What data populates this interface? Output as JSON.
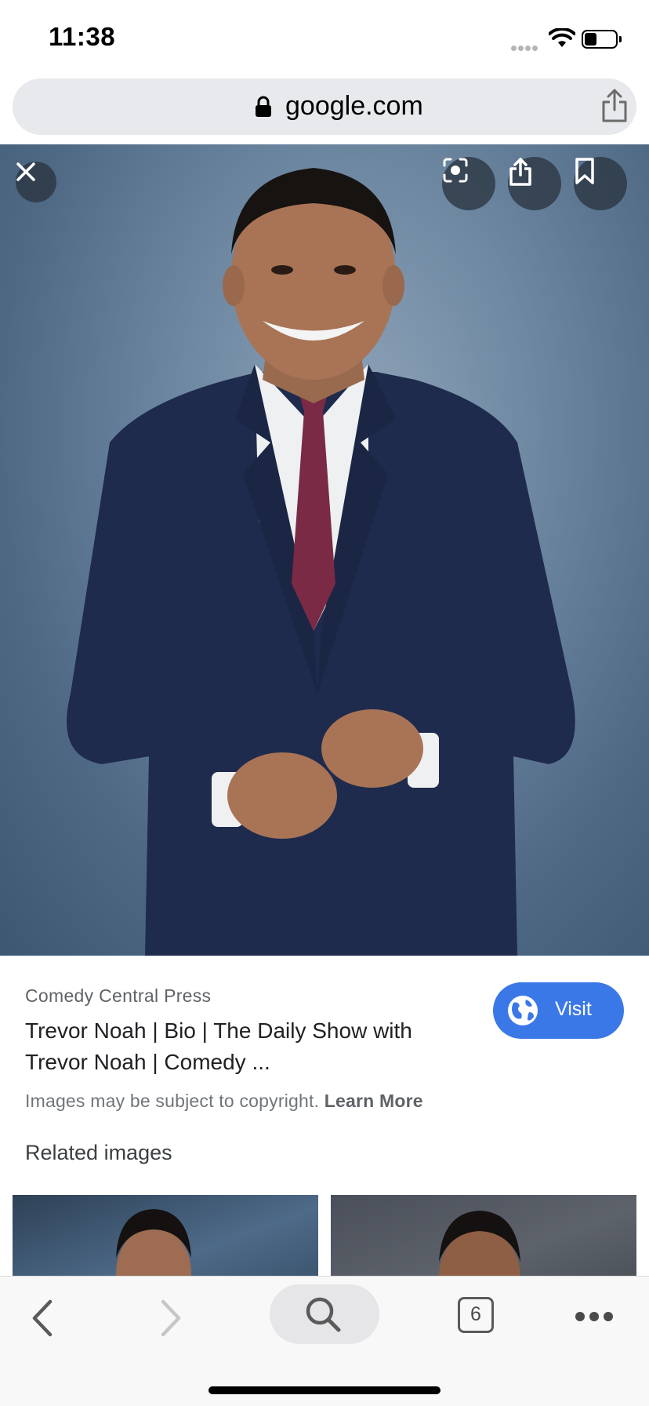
{
  "status_bar": {
    "time": "11:38",
    "battery_level": 0.35
  },
  "address_bar": {
    "url": "google.com",
    "icons": [
      "lock-icon",
      "share-icon"
    ]
  },
  "image_viewer": {
    "buttons": [
      "close-icon",
      "lens-icon",
      "share-icon",
      "bookmark-icon"
    ]
  },
  "result": {
    "source": "Comedy Central Press",
    "title": "Trevor Noah | Bio | The Daily Show with Trevor Noah | Comedy ...",
    "visit_label": "Visit",
    "copyright_text": "Images may be subject to copyright.",
    "learn_more": "Learn More",
    "related_heading": "Related images"
  },
  "toolbar": {
    "tab_count": "6",
    "icons": [
      "back-icon",
      "forward-icon",
      "search-icon",
      "tabs-icon",
      "more-icon"
    ]
  },
  "colors": {
    "accent": "#3b78e7",
    "address_bar_bg": "#e8e9ec",
    "photo_bg": "#5f7a96"
  }
}
